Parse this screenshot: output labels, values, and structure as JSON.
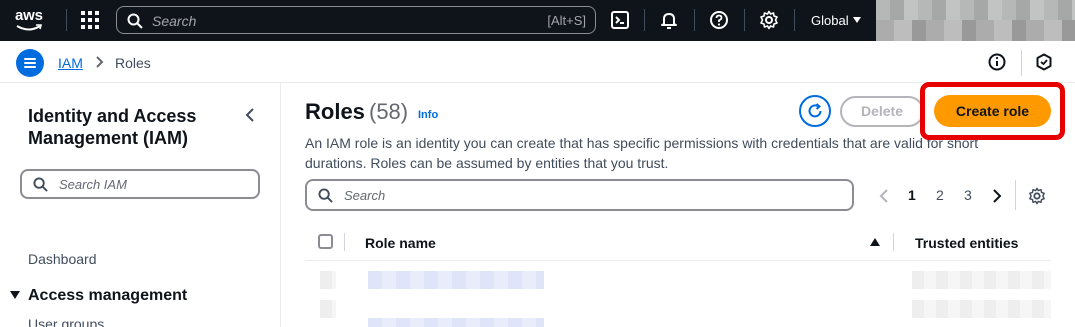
{
  "topnav": {
    "logo_text": "aws",
    "search_placeholder": "Search",
    "search_shortcut": "[Alt+S]",
    "region": "Global",
    "icons": [
      "services-grid-icon",
      "search-icon",
      "cloudshell-icon",
      "bell-icon",
      "help-icon",
      "gear-icon"
    ]
  },
  "breadcrumb": {
    "items": [
      "IAM",
      "Roles"
    ]
  },
  "sidebar": {
    "title": "Identity and Access Management (IAM)",
    "search_placeholder": "Search IAM",
    "dashboard": "Dashboard",
    "section": "Access management",
    "user_groups": "User groups"
  },
  "main": {
    "title": "Roles",
    "count": "(58)",
    "info": "Info",
    "description": "An IAM role is an identity you can create that has specific permissions with credentials that are valid for short durations. Roles can be assumed by entities that you trust.",
    "delete_label": "Delete",
    "create_label": "Create role",
    "search_placeholder": "Search",
    "pages": [
      "1",
      "2",
      "3"
    ],
    "current_page": "1",
    "columns": [
      "Role name",
      "Trusted entities"
    ]
  },
  "colors": {
    "nav_bg": "#0f141a",
    "accent": "#006ce0",
    "primary_button": "#ff9900",
    "highlight_box": "#e60000"
  }
}
